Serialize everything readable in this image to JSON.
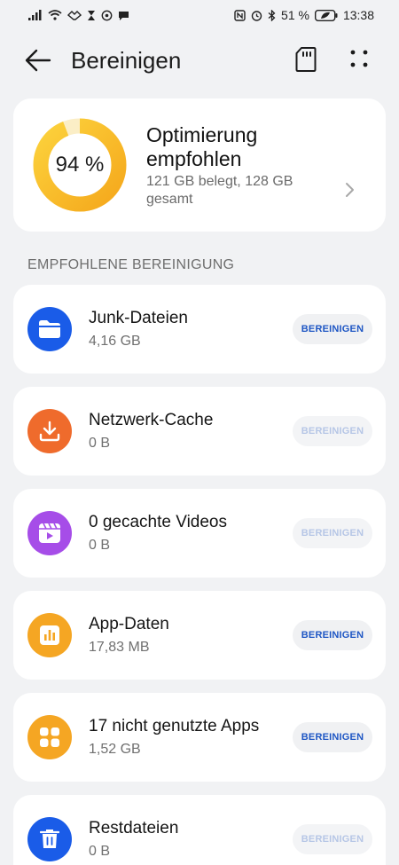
{
  "status_bar": {
    "battery": "51 %",
    "time": "13:38"
  },
  "header": {
    "title": "Bereinigen"
  },
  "summary": {
    "percent": 94,
    "percent_label": "94 %",
    "title": "Optimierung empfohlen",
    "subtitle": "121 GB belegt, 128 GB gesamt"
  },
  "section_title": "EMPFOHLENE BEREINIGUNG",
  "items": [
    {
      "title": "Junk-Dateien",
      "size": "4,16 GB",
      "button": "BEREINIGEN",
      "enabled": true,
      "icon": "folder-icon",
      "color": "#1a5ce8"
    },
    {
      "title": "Netzwerk-Cache",
      "size": "0 B",
      "button": "BEREINIGEN",
      "enabled": false,
      "icon": "download-icon",
      "color": "#ef6b2c"
    },
    {
      "title": "0 gecachte Videos",
      "size": "0 B",
      "button": "BEREINIGEN",
      "enabled": false,
      "icon": "video-icon",
      "color": "#a64de8"
    },
    {
      "title": "App-Daten",
      "size": "17,83 MB",
      "button": "BEREINIGEN",
      "enabled": true,
      "icon": "bar-chart-icon",
      "color": "#f5a623"
    },
    {
      "title": "17 nicht genutzte Apps",
      "size": "1,52 GB",
      "button": "BEREINIGEN",
      "enabled": true,
      "icon": "apps-grid-icon",
      "color": "#f5a623"
    },
    {
      "title": "Restdateien",
      "size": "0 B",
      "button": "BEREINIGEN",
      "enabled": false,
      "icon": "trash-icon",
      "color": "#1a5ce8"
    }
  ],
  "colors": {
    "ring_start": "#f5a81c",
    "ring_end": "#fcd23c",
    "accent": "#1e56c4"
  }
}
